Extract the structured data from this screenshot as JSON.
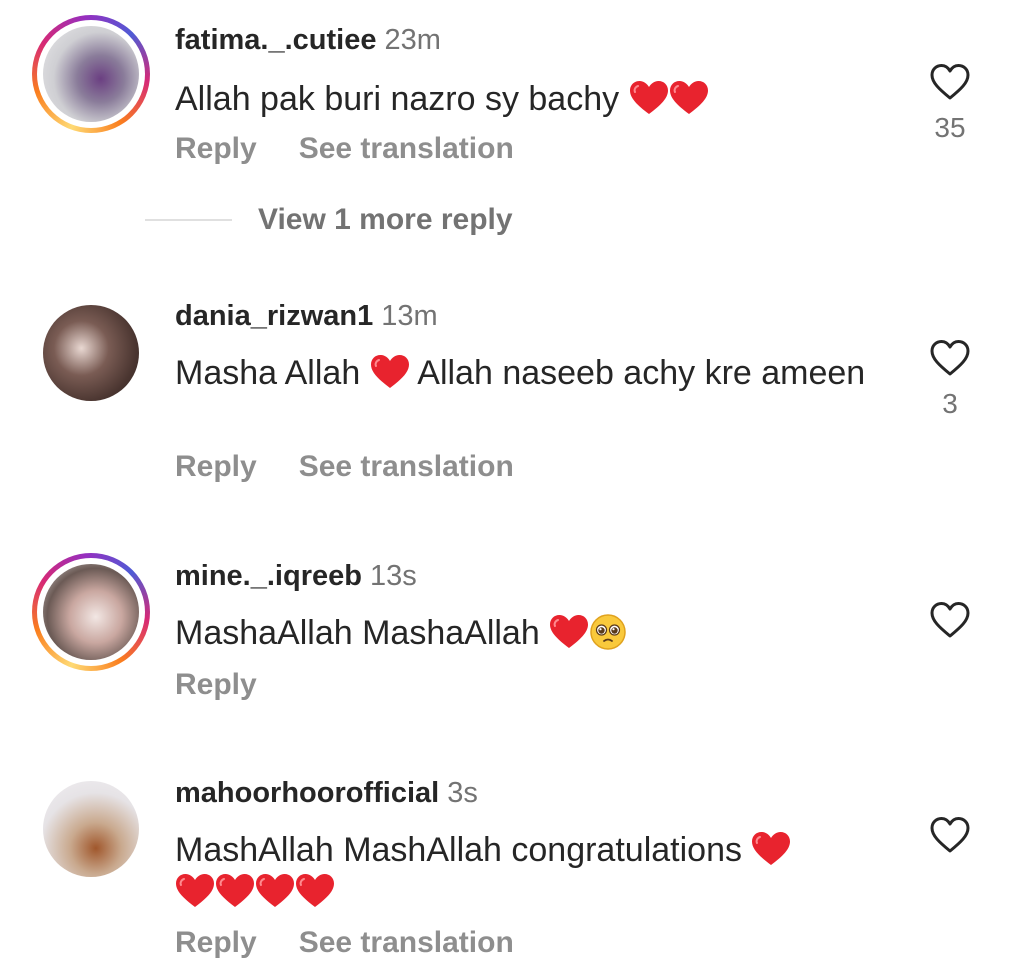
{
  "comments": [
    {
      "username": "fatima._.cutiee",
      "time": "23m",
      "text": "Allah pak buri nazro sy bachy",
      "reply_label": "Reply",
      "translate_label": "See translation",
      "likes": "35",
      "avatar_icon": "profile-photo",
      "has_story_ring": true
    },
    {
      "username": "dania_rizwan1",
      "time": "13m",
      "text_before": "Masha Allah",
      "text_after": "Allah naseeb achy kre ameen",
      "reply_label": "Reply",
      "translate_label": "See translation",
      "likes": "3",
      "avatar_icon": "profile-photo",
      "has_story_ring": false
    },
    {
      "username": "mine._.iqreeb",
      "time": "13s",
      "text": "MashaAllah MashaAllah",
      "reply_label": "Reply",
      "avatar_icon": "profile-photo",
      "has_story_ring": true
    },
    {
      "username": "mahoorhoorofficial",
      "time": "3s",
      "text": "MashAllah MashAllah congratulations",
      "reply_label": "Reply",
      "translate_label": "See translation",
      "avatar_icon": "profile-photo",
      "has_story_ring": false
    }
  ],
  "view_more_replies": "View 1 more reply",
  "icons": {
    "like": "heart-outline-icon",
    "emoji_heart": "red-heart-emoji",
    "emoji_face": "pleading-face-emoji"
  },
  "colors": {
    "text": "#262626",
    "muted": "#737373",
    "action": "#8e8e8e",
    "heart": "#e8232e"
  }
}
